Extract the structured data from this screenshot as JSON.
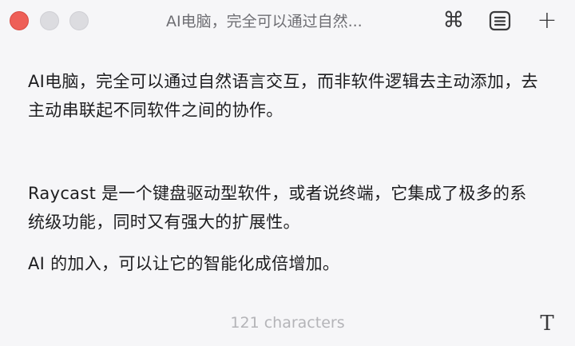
{
  "window": {
    "title": "AI电脑，完全可以通过自然...",
    "traffic_lights": {
      "close_color": "#ee5f57",
      "min_color": "#dcdce0",
      "zoom_color": "#dcdce0"
    }
  },
  "toolbar": {
    "command_icon": "⌘",
    "notes_icon": "notes-list-icon",
    "add_icon": "+"
  },
  "note": {
    "paragraphs": [
      "AI电脑，完全可以通过自然语言交互，而非软件逻辑去主动添加，去主动串联起不同软件之间的协作。",
      "Raycast 是一个键盘驱动型软件，或者说终端，它集成了极多的系统级功能，同时又有强大的扩展性。",
      "AI 的加入，可以让它的智能化成倍增加。"
    ]
  },
  "footer": {
    "character_count": "121 characters",
    "format_icon": "T"
  }
}
